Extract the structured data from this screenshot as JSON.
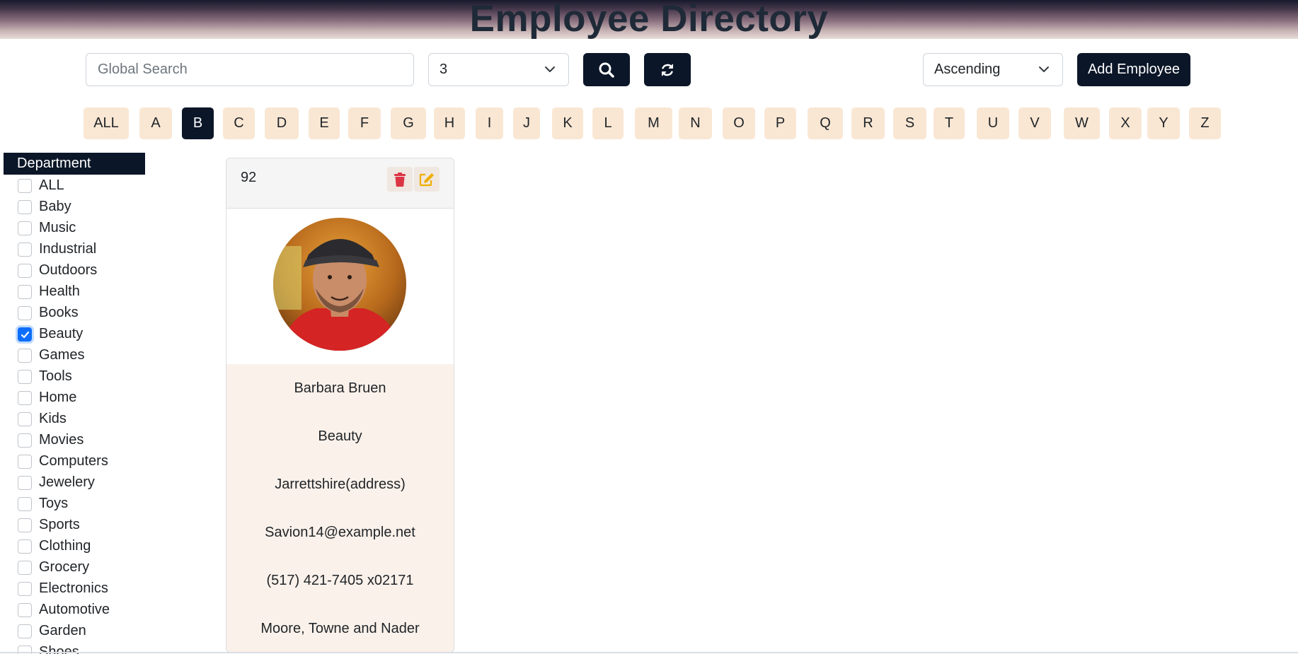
{
  "header": {
    "title": "Employee Directory"
  },
  "toolbar": {
    "search_placeholder": "Global Search",
    "page_size_value": "3",
    "sort_value": "Ascending",
    "add_label": "Add Employee"
  },
  "alphabet": {
    "letters": [
      "ALL",
      "A",
      "B",
      "C",
      "D",
      "E",
      "F",
      "G",
      "H",
      "I",
      "J",
      "K",
      "L",
      "M",
      "N",
      "O",
      "P",
      "Q",
      "R",
      "S",
      "T",
      "U",
      "V",
      "W",
      "X",
      "Y",
      "Z"
    ],
    "selected": "B"
  },
  "sidebar": {
    "title": "Department",
    "items": [
      {
        "label": "ALL",
        "checked": false
      },
      {
        "label": "Baby",
        "checked": false
      },
      {
        "label": "Music",
        "checked": false
      },
      {
        "label": "Industrial",
        "checked": false
      },
      {
        "label": "Outdoors",
        "checked": false
      },
      {
        "label": "Health",
        "checked": false
      },
      {
        "label": "Books",
        "checked": false
      },
      {
        "label": "Beauty",
        "checked": true
      },
      {
        "label": "Games",
        "checked": false
      },
      {
        "label": "Tools",
        "checked": false
      },
      {
        "label": "Home",
        "checked": false
      },
      {
        "label": "Kids",
        "checked": false
      },
      {
        "label": "Movies",
        "checked": false
      },
      {
        "label": "Computers",
        "checked": false
      },
      {
        "label": "Jewelery",
        "checked": false
      },
      {
        "label": "Toys",
        "checked": false
      },
      {
        "label": "Sports",
        "checked": false
      },
      {
        "label": "Clothing",
        "checked": false
      },
      {
        "label": "Grocery",
        "checked": false
      },
      {
        "label": "Electronics",
        "checked": false
      },
      {
        "label": "Automotive",
        "checked": false
      },
      {
        "label": "Garden",
        "checked": false
      },
      {
        "label": "Shoes",
        "checked": false
      }
    ]
  },
  "card": {
    "id": "92",
    "name": "Barbara Bruen",
    "department": "Beauty",
    "address": "Jarrettshire(address)",
    "email": "Savion14@example.net",
    "phone": "(517) 421-7405 x02171",
    "company": "Moore, Towne and Nader"
  },
  "colors": {
    "primary_dark": "#0b1628",
    "letter_bg": "#f9e7d4",
    "card_body_bg": "#faf1ea",
    "delete_icon": "#dc3545",
    "edit_icon": "#f0ad00",
    "checkbox_checked": "#0d6efd"
  },
  "icons": {
    "search_button": "search-icon",
    "refresh_button": "refresh-icon",
    "delete_button": "trash-icon",
    "edit_button": "edit-icon",
    "select_chevron": "chevron-down-icon"
  }
}
